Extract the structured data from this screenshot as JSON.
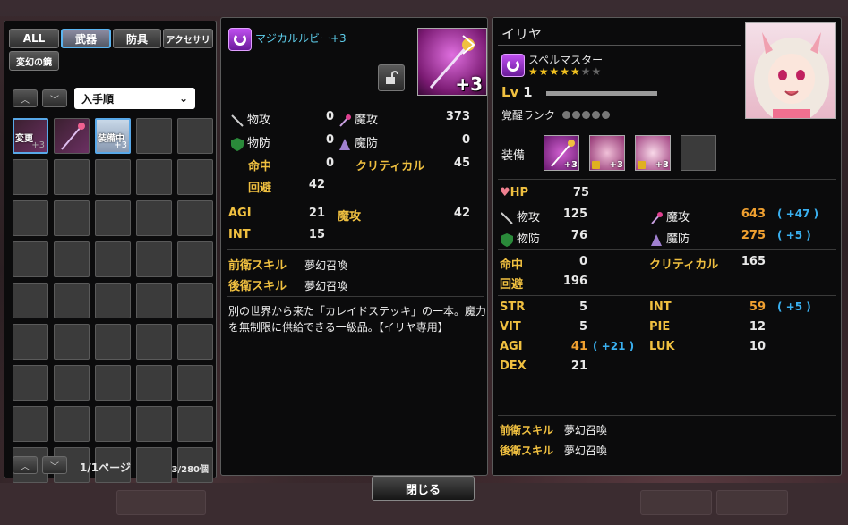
{
  "filters": {
    "all": "ALL",
    "weapon": "武器",
    "armor": "防具",
    "accessory": "アクセサリ",
    "mirror": "変幻の鏡"
  },
  "sort": {
    "label": "入手順"
  },
  "inventory": {
    "tag_change": "変更",
    "tag_equipped": "装備中",
    "plus": "+3",
    "pager": "1/1ページ",
    "count": "3/280個"
  },
  "item": {
    "name": "マジカルルビー+3",
    "plus": "+3",
    "stats": {
      "phys_atk_label": "物攻",
      "phys_atk": "0",
      "mag_atk_label": "魔攻",
      "mag_atk": "373",
      "phys_def_label": "物防",
      "phys_def": "0",
      "mag_def_label": "魔防",
      "mag_def": "0",
      "hit_label": "命中",
      "hit": "0",
      "crit_label": "クリティカル",
      "crit": "45",
      "evade_label": "回避",
      "evade": "42"
    },
    "bonus": {
      "agi_label": "AGI",
      "agi": "21",
      "mag_atk_label": "魔攻",
      "mag_atk": "42",
      "int_label": "INT",
      "int": "15"
    },
    "skills": {
      "front_label": "前衛スキル",
      "front": "夢幻召喚",
      "back_label": "後衛スキル",
      "back": "夢幻召喚"
    },
    "description": "別の世界から来た「カレイドステッキ」の一本。魔力を無制限に供給できる一級品。【イリヤ専用】"
  },
  "character": {
    "name": "イリヤ",
    "class": "スペルマスター",
    "lv_label": "Lv",
    "lv": "1",
    "awaken_label": "覚醒ランク",
    "equip_label": "装備",
    "eq_plus": "+3",
    "hp_label": "HP",
    "hp": "75",
    "phys_atk_label": "物攻",
    "phys_atk": "125",
    "mag_atk_label": "魔攻",
    "mag_atk": "643",
    "mag_atk_bonus": "( +47 )",
    "phys_def_label": "物防",
    "phys_def": "76",
    "mag_def_label": "魔防",
    "mag_def": "275",
    "mag_def_bonus": "( +5 )",
    "hit_label": "命中",
    "hit": "0",
    "crit_label": "クリティカル",
    "crit": "165",
    "evade_label": "回避",
    "evade": "196",
    "str_label": "STR",
    "str": "5",
    "int_label": "INT",
    "int": "59",
    "int_bonus": "( +5 )",
    "vit_label": "VIT",
    "vit": "5",
    "pie_label": "PIE",
    "pie": "12",
    "agi_label": "AGI",
    "agi": "41",
    "agi_bonus": "( +21 )",
    "luk_label": "LUK",
    "luk": "10",
    "dex_label": "DEX",
    "dex": "21",
    "front_label": "前衛スキル",
    "front": "夢幻召喚",
    "back_label": "後衛スキル",
    "back": "夢幻召喚"
  },
  "close_label": "閉じる",
  "colors": {
    "accent": "#5ab4f0",
    "label": "#f0c040",
    "bonus": "#3ab0f0",
    "boosted": "#f0a030"
  }
}
